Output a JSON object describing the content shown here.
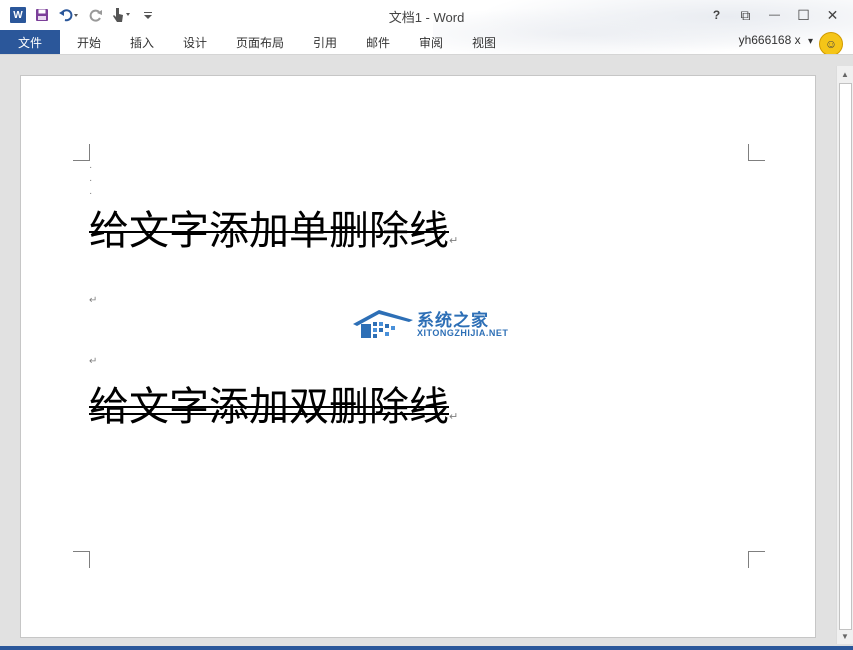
{
  "window": {
    "title": "文档1 - Word",
    "help_label": "?",
    "ribbon_display_label": "⧉",
    "minimize_label": "—",
    "maximize_label": "☐",
    "close_label": "✕"
  },
  "quick_access": {
    "app_icon_label": "W",
    "save_icon": "save-icon",
    "undo_icon": "undo-icon",
    "redo_icon": "redo-icon",
    "touch_mode_icon": "touch-mode-icon",
    "customize_icon": "customize-qat-icon"
  },
  "ribbon": {
    "tabs": [
      {
        "label": "文件"
      },
      {
        "label": "开始"
      },
      {
        "label": "插入"
      },
      {
        "label": "设计"
      },
      {
        "label": "页面布局"
      },
      {
        "label": "引用"
      },
      {
        "label": "邮件"
      },
      {
        "label": "审阅"
      },
      {
        "label": "视图"
      }
    ],
    "user": "yh666168 x",
    "user_dropdown": "▾"
  },
  "document": {
    "line1": "给文字添加单删除线",
    "line2": "给文字添加双删除线",
    "paragraph_mark": "↵",
    "small_mark": "·"
  },
  "watermark": {
    "cn": "系统之家",
    "en": "XITONGZHIJIA.NET"
  },
  "colors": {
    "accent": "#2b579a",
    "watermark": "#2d6fb6"
  }
}
